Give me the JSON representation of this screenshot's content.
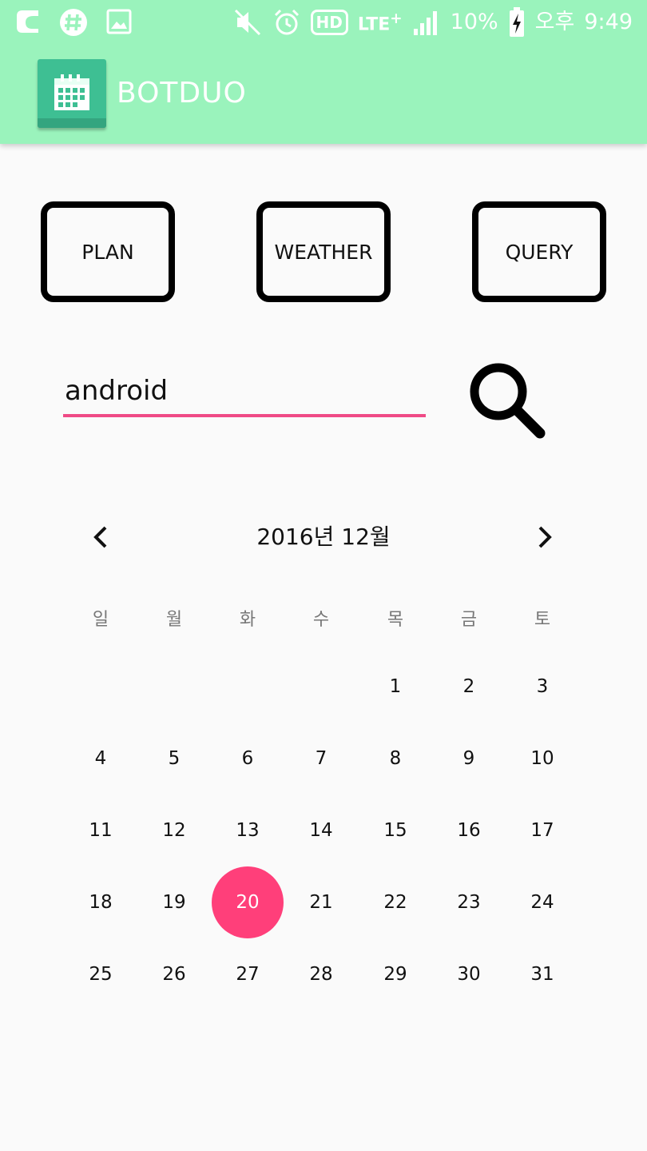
{
  "status_bar": {
    "battery": "10%",
    "period": "오후",
    "time": "9:49",
    "network": "LTE",
    "network_plus": "+",
    "hd_label": "HD",
    "left_icons": [
      "circle-app-icon",
      "slack-icon",
      "image-icon"
    ],
    "right_icons": [
      "mute-icon",
      "alarm-icon",
      "signal-icon",
      "battery-charging-icon"
    ]
  },
  "app": {
    "title": "BOTDUO",
    "logo_icon": "calendar-icon",
    "colors": {
      "appbar": "#9af3bc",
      "logo": "#3ebf93",
      "accent": "#ff3f7a",
      "underline": "#ef4a86"
    }
  },
  "buttons": {
    "plan": "PLAN",
    "weather": "WEATHER",
    "query": "QUERY"
  },
  "search": {
    "value": "android",
    "icon": "search-icon"
  },
  "calendar": {
    "title": "2016년 12월",
    "prev_icon": "chevron-left-icon",
    "next_icon": "chevron-right-icon",
    "weekdays": [
      "일",
      "월",
      "화",
      "수",
      "목",
      "금",
      "토"
    ],
    "weeks": [
      [
        "",
        "",
        "",
        "",
        "1",
        "2",
        "3"
      ],
      [
        "4",
        "5",
        "6",
        "7",
        "8",
        "9",
        "10"
      ],
      [
        "11",
        "12",
        "13",
        "14",
        "15",
        "16",
        "17"
      ],
      [
        "18",
        "19",
        "20",
        "21",
        "22",
        "23",
        "24"
      ],
      [
        "25",
        "26",
        "27",
        "28",
        "29",
        "30",
        "31"
      ]
    ],
    "selected_day": "20"
  }
}
